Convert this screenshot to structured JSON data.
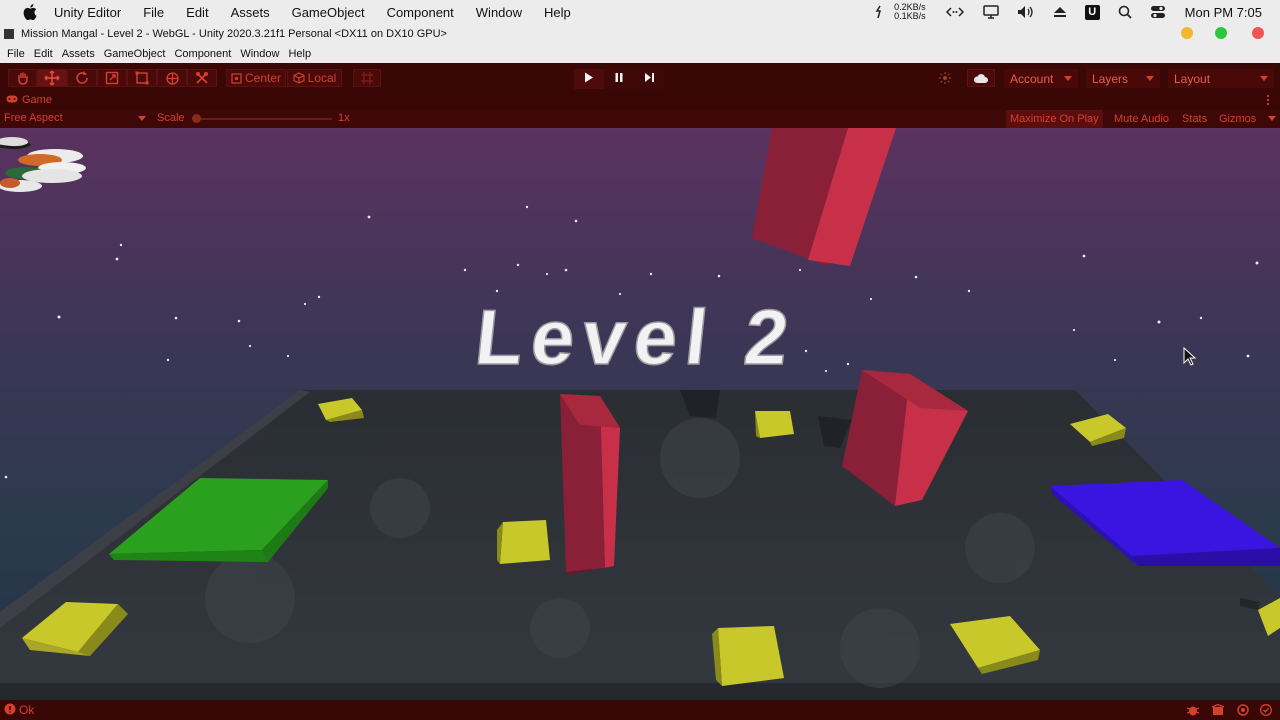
{
  "mac_menu": {
    "app_name": "Unity Editor",
    "items": [
      "File",
      "Edit",
      "Assets",
      "GameObject",
      "Component",
      "Window",
      "Help"
    ]
  },
  "mac_status": {
    "upload": "0.2KB/s",
    "download": "0.1KB/s",
    "clock": "Mon PM 7:05",
    "badge_letter": "U"
  },
  "window": {
    "title": "Mission Mangal - Level 2 - WebGL - Unity 2020.3.21f1 Personal <DX11 on DX10 GPU>"
  },
  "unity_menu": {
    "items": [
      "File",
      "Edit",
      "Assets",
      "GameObject",
      "Component",
      "Window",
      "Help"
    ]
  },
  "toolbar": {
    "pivot_label": "Center",
    "space_label": "Local",
    "account_label": "Account",
    "layers_label": "Layers",
    "layout_label": "Layout"
  },
  "game_tab": {
    "label": "Game"
  },
  "game_bar": {
    "aspect": "Free Aspect",
    "scale_label": "Scale",
    "scale_value": "1x",
    "maximize": "Maximize On Play",
    "mute": "Mute Audio",
    "stats": "Stats",
    "gizmos": "Gizmos"
  },
  "scene": {
    "level_text": "Level 2"
  },
  "status_bar": {
    "message": "Ok"
  },
  "colors": {
    "accent": "#d3402e",
    "toolbar_bg": "#3a0707",
    "platform_green": "#2aa01e",
    "platform_blue": "#3a14e0",
    "coin_yellow": "#c9c82a",
    "obstacle_red": "#c8304a"
  }
}
